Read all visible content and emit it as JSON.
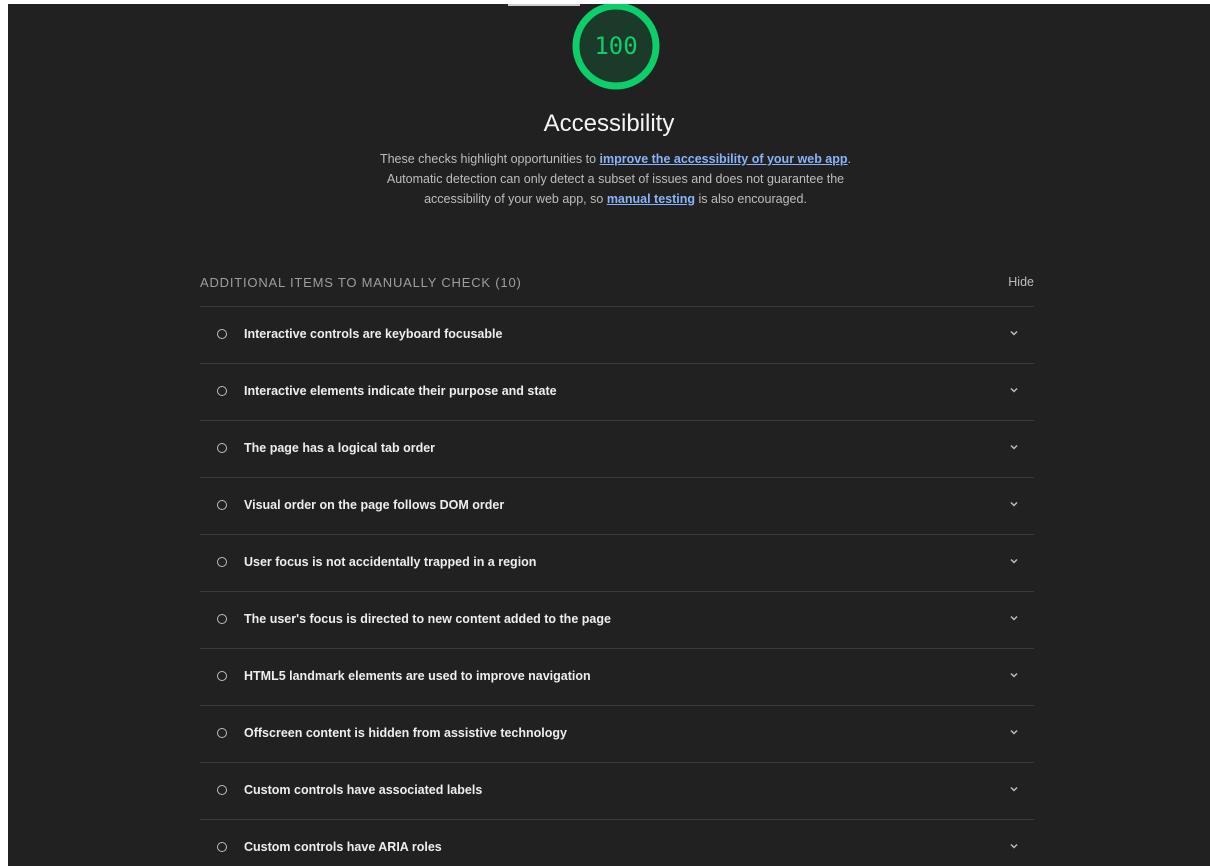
{
  "score": {
    "value": "100",
    "fraction": 1.0,
    "color": "#0cce6b"
  },
  "category": {
    "title": "Accessibility",
    "description": {
      "part1": "These checks highlight opportunities to ",
      "link1": "improve the accessibility of your web app",
      "part2": ". Automatic detection can only detect a subset of issues and does not guarantee the accessibility of your web app, so ",
      "link2": "manual testing",
      "part3": " is also encouraged."
    }
  },
  "group": {
    "title": "ADDITIONAL ITEMS TO MANUALLY CHECK (10)",
    "toggle_label": "Hide"
  },
  "audits": [
    {
      "title": "Interactive controls are keyboard focusable"
    },
    {
      "title": "Interactive elements indicate their purpose and state"
    },
    {
      "title": "The page has a logical tab order"
    },
    {
      "title": "Visual order on the page follows DOM order"
    },
    {
      "title": "User focus is not accidentally trapped in a region"
    },
    {
      "title": "The user's focus is directed to new content added to the page"
    },
    {
      "title": "HTML5 landmark elements are used to improve navigation"
    },
    {
      "title": "Offscreen content is hidden from assistive technology"
    },
    {
      "title": "Custom controls have associated labels"
    },
    {
      "title": "Custom controls have ARIA roles"
    }
  ],
  "icons": {
    "audit_marker": "circle-outline-icon",
    "expand": "chevron-down-icon"
  },
  "colors": {
    "background": "#212121",
    "link": "#8ab4f8",
    "pass": "#0cce6b"
  }
}
